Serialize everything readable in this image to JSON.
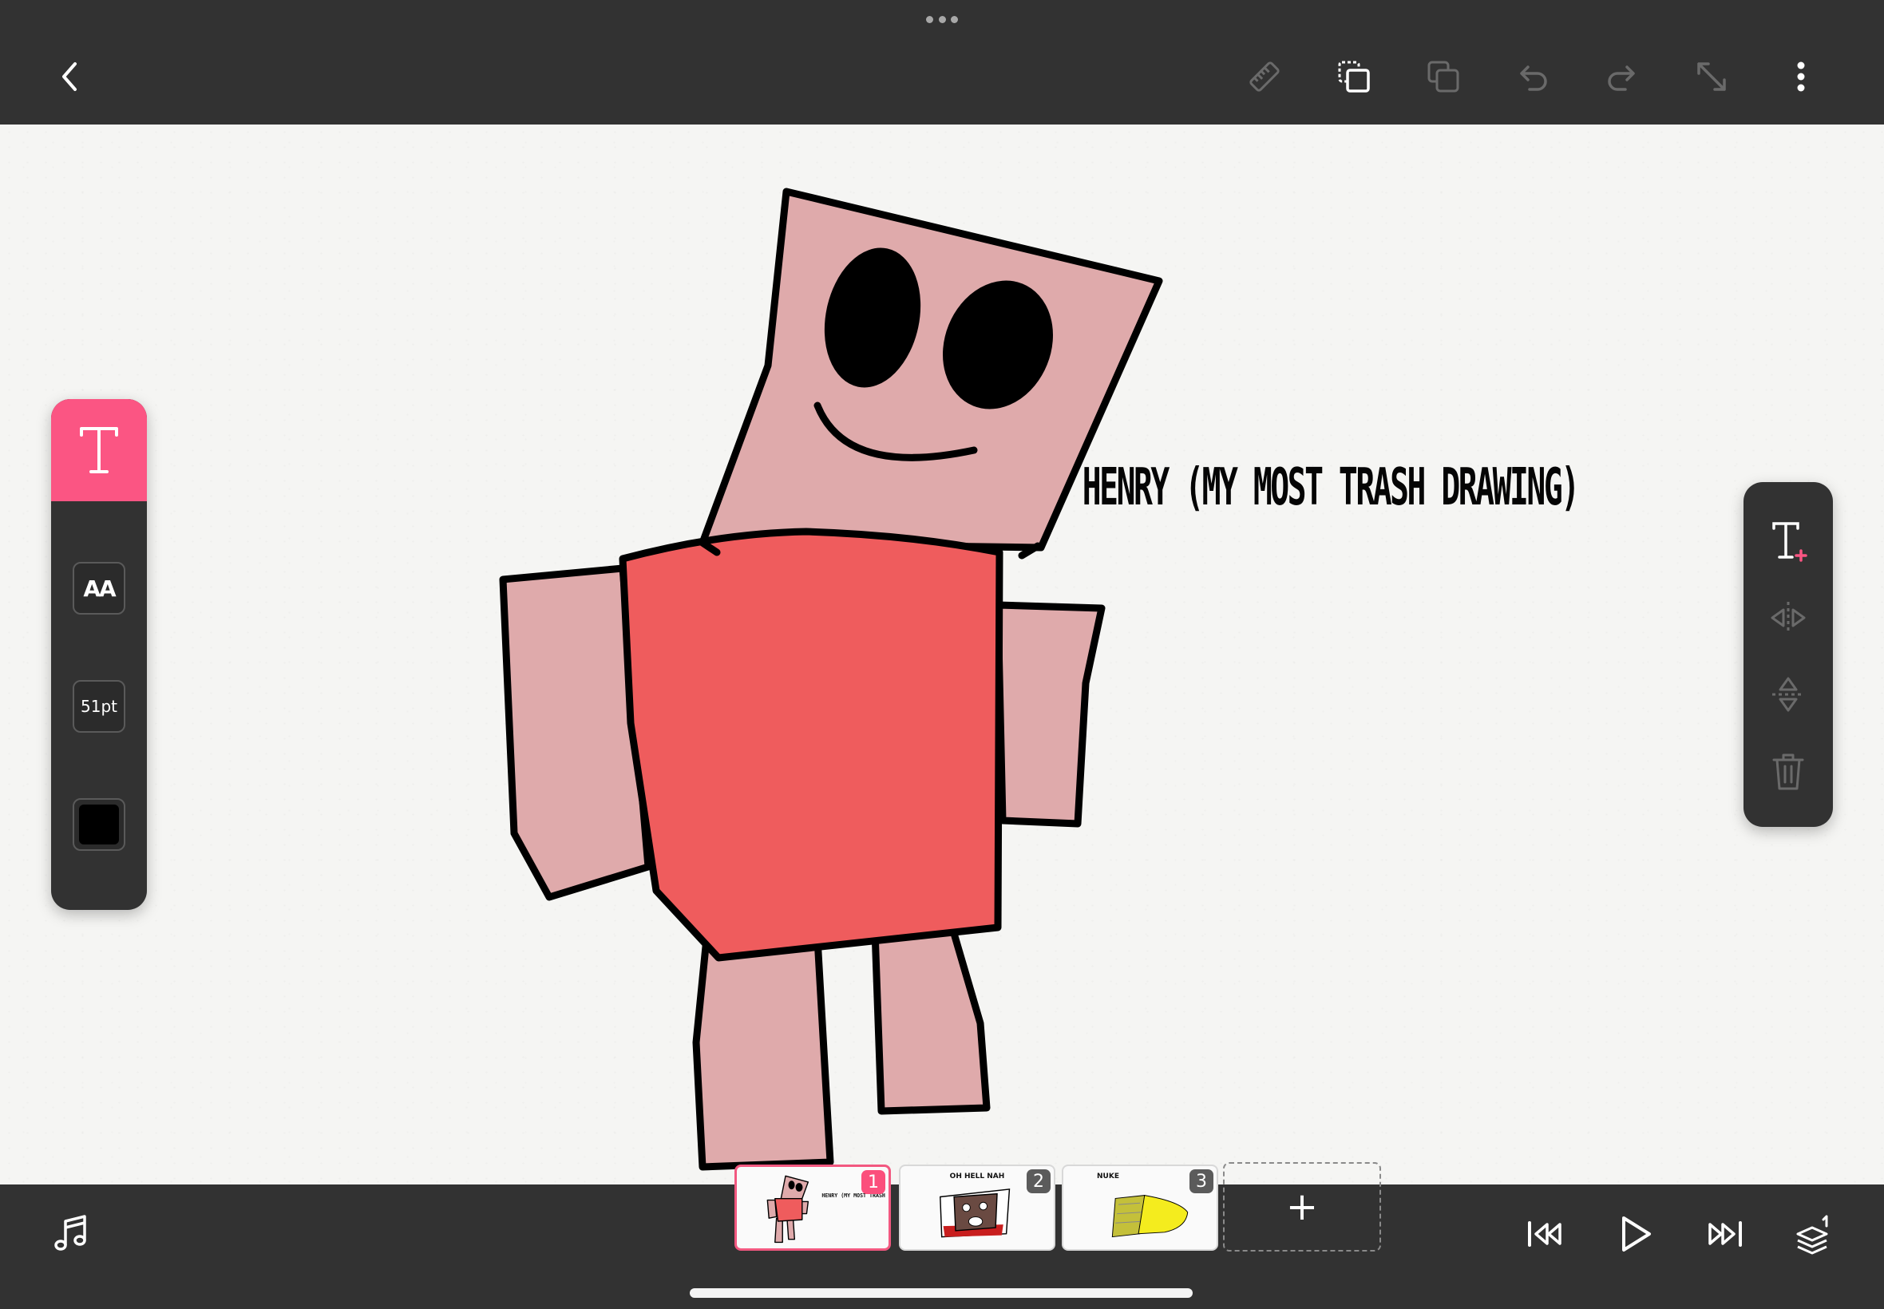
{
  "canvas": {
    "text_layer": "HENRY (MY MOST TRASH DRAWING)"
  },
  "text_panel": {
    "font_label": "AA",
    "size_label": "51pt",
    "color": "#000000",
    "accent": "#fb5583"
  },
  "timeline": {
    "frames": [
      {
        "number": "1",
        "caption": "",
        "active": true
      },
      {
        "number": "2",
        "caption": "OH HELL NAH",
        "active": false
      },
      {
        "number": "3",
        "caption": "NUKE",
        "active": false
      }
    ],
    "add_label": "+"
  },
  "icons": {
    "top": [
      "back-icon",
      "ruler-icon",
      "select-copy-icon",
      "duplicate-icon",
      "undo-icon",
      "redo-icon",
      "resize-icon",
      "more-icon"
    ],
    "right": [
      "add-text-icon",
      "flip-horizontal-icon",
      "flip-vertical-icon",
      "trash-icon"
    ],
    "bottom": [
      "music-icon",
      "skip-to-start-icon",
      "play-icon",
      "skip-to-end-icon",
      "layers-icon"
    ]
  }
}
